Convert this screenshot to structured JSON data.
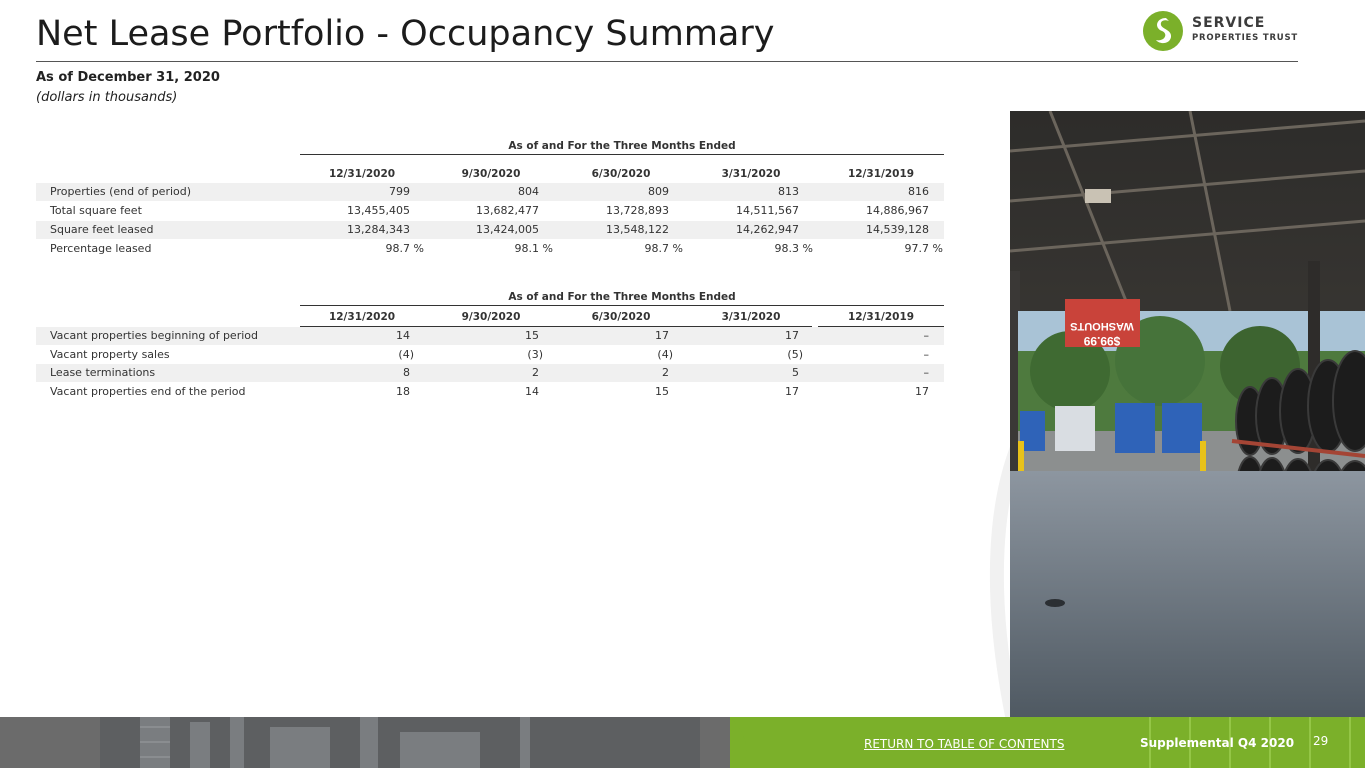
{
  "header": {
    "title": "Net Lease Portfolio - Occupancy Summary",
    "as_of": "As of December 31, 2020",
    "units": "(dollars in thousands)"
  },
  "logo": {
    "line1": "SERVICE",
    "line2": "PROPERTIES TRUST",
    "icon": "spt-leaf-icon"
  },
  "table1": {
    "group_header": "As of and For the Three Months Ended",
    "columns": [
      "12/31/2020",
      "9/30/2020",
      "6/30/2020",
      "3/31/2020",
      "12/31/2019"
    ],
    "rows": [
      {
        "label": "Properties (end of period)",
        "values": [
          "799",
          "804",
          "809",
          "813",
          "816"
        ]
      },
      {
        "label": "Total square feet",
        "values": [
          "13,455,405",
          "13,682,477",
          "13,728,893",
          "14,511,567",
          "14,886,967"
        ]
      },
      {
        "label": "Square feet leased",
        "values": [
          "13,284,343",
          "13,424,005",
          "13,548,122",
          "14,262,947",
          "14,539,128"
        ]
      },
      {
        "label": "Percentage leased",
        "values": [
          "98.7 %",
          "98.1 %",
          "98.7 %",
          "98.3 %",
          "97.7 %"
        ]
      }
    ]
  },
  "table2": {
    "group_header": "As of and For the Three Months Ended",
    "columns": [
      "12/31/2020",
      "9/30/2020",
      "6/30/2020",
      "3/31/2020",
      "12/31/2019"
    ],
    "rows": [
      {
        "label": "Vacant properties beginning of period",
        "values": [
          "14",
          "15",
          "17",
          "17",
          "–"
        ]
      },
      {
        "label": "Vacant property sales",
        "values": [
          "(4)",
          "(3)",
          "(4)",
          "(5)",
          "–"
        ]
      },
      {
        "label": "Lease terminations",
        "values": [
          "8",
          "2",
          "2",
          "5",
          "–"
        ]
      },
      {
        "label": "Vacant properties end of the period",
        "values": [
          "18",
          "14",
          "15",
          "17",
          "17"
        ]
      }
    ]
  },
  "photo": {
    "sign_line1": "WASHOUTS",
    "sign_line2": "$99.99"
  },
  "footer": {
    "toc_link": "RETURN TO TABLE OF CONTENTS",
    "supplemental": "Supplemental Q4 2020",
    "page_number": "29"
  },
  "colors": {
    "brand_green": "#7bb02a",
    "footer_gray": "#6b6b6b",
    "row_shade": "#f0f0f0"
  }
}
